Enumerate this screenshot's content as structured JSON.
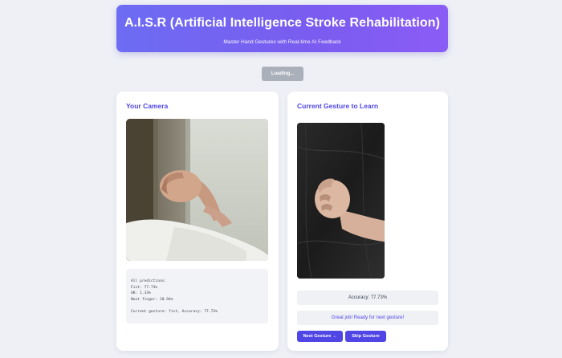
{
  "header": {
    "title": "A.I.S.R (Artificial Intelligence Stroke Rehabilitation)",
    "subtitle": "Master Hand Gestures with Real-time AI Feedback"
  },
  "status": {
    "loading_label": "Loading..."
  },
  "camera_panel": {
    "title": "Your Camera",
    "image": "webcam-feed-fist-gesture",
    "predictions_heading": "All predictions:",
    "predictions": [
      "Fist: 77.73%",
      "OK: 1.33%",
      "Next finger: 20.94%"
    ],
    "current_gesture_line": "Current gesture: fist, Accuracy: 77.73%"
  },
  "gesture_panel": {
    "title": "Current Gesture to Learn",
    "image": "reference-fist-gesture",
    "accuracy_text": "Accuracy: 77.73%",
    "feedback_text": "Great job! Ready for next gesture!",
    "next_button": "Next Gesture →",
    "skip_button": "Skip Gesture"
  },
  "colors": {
    "accent": "#4f46e5",
    "header_gradient_start": "#6d6cf3",
    "header_gradient_end": "#8b5cf6",
    "background": "#eef0f6",
    "loading_button": "#a9b0ba"
  }
}
